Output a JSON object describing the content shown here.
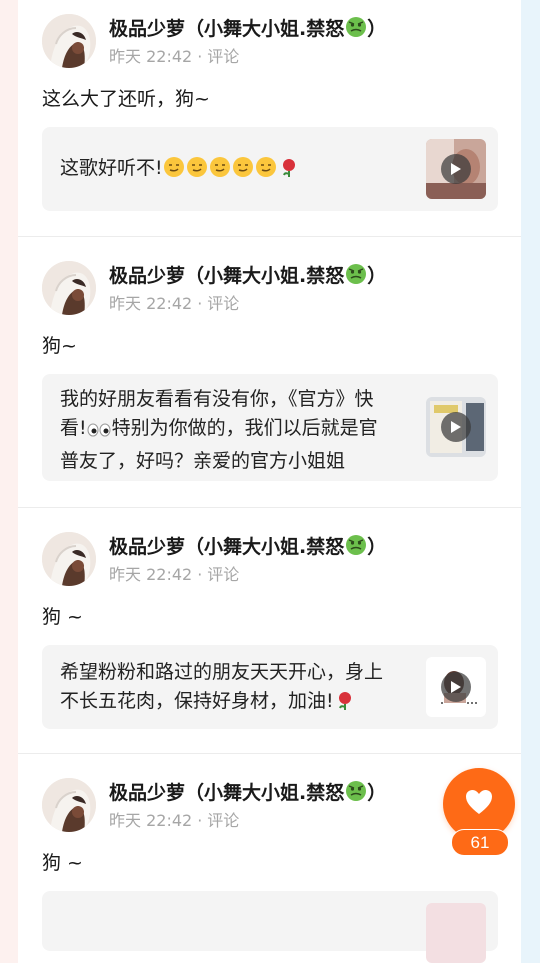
{
  "posts": [
    {
      "author": "极品少萝（小舞大小姐.禁怒",
      "author_end": "）",
      "time": "昨天 22:42",
      "dot": "·",
      "action": "评论",
      "comment": "这么大了还听，狗~",
      "quote": "这歌好听不!",
      "quote_suffix_icons": [
        "smirk-face-icon",
        "smirk-face-icon",
        "smirk-face-icon",
        "smirk-face-icon",
        "smirk-face-icon",
        "rose-icon"
      ]
    },
    {
      "author": "极品少萝（小舞大小姐.禁怒",
      "author_end": "）",
      "time": "昨天 22:42",
      "dot": "·",
      "action": "评论",
      "comment": "狗~",
      "quote_line1": "我的好朋友看看有没有你，《官方》快",
      "quote_line2a": "看!",
      "quote_line2b": "特别为你做的，我们以后就是官",
      "quote_line3": "普友了，好吗？亲爱的官方小姐姐"
    },
    {
      "author": "极品少萝（小舞大小姐.禁怒",
      "author_end": "）",
      "time": "昨天 22:42",
      "dot": "·",
      "action": "评论",
      "comment": "狗 ~",
      "quote_line1": "希望粉粉和路过的朋友天天开心，身上",
      "quote_line2": "不长五花肉，保持好身材，加油!"
    },
    {
      "author": "极品少萝（小舞大小姐.禁怒",
      "author_end": "）",
      "time": "昨天 22:42",
      "dot": "·",
      "action": "评论",
      "comment": "狗 ~"
    }
  ],
  "like_count": "61",
  "colors": {
    "accent": "#fe6a16",
    "meta": "#a6a6a6",
    "quote_bg": "#f4f4f4"
  }
}
